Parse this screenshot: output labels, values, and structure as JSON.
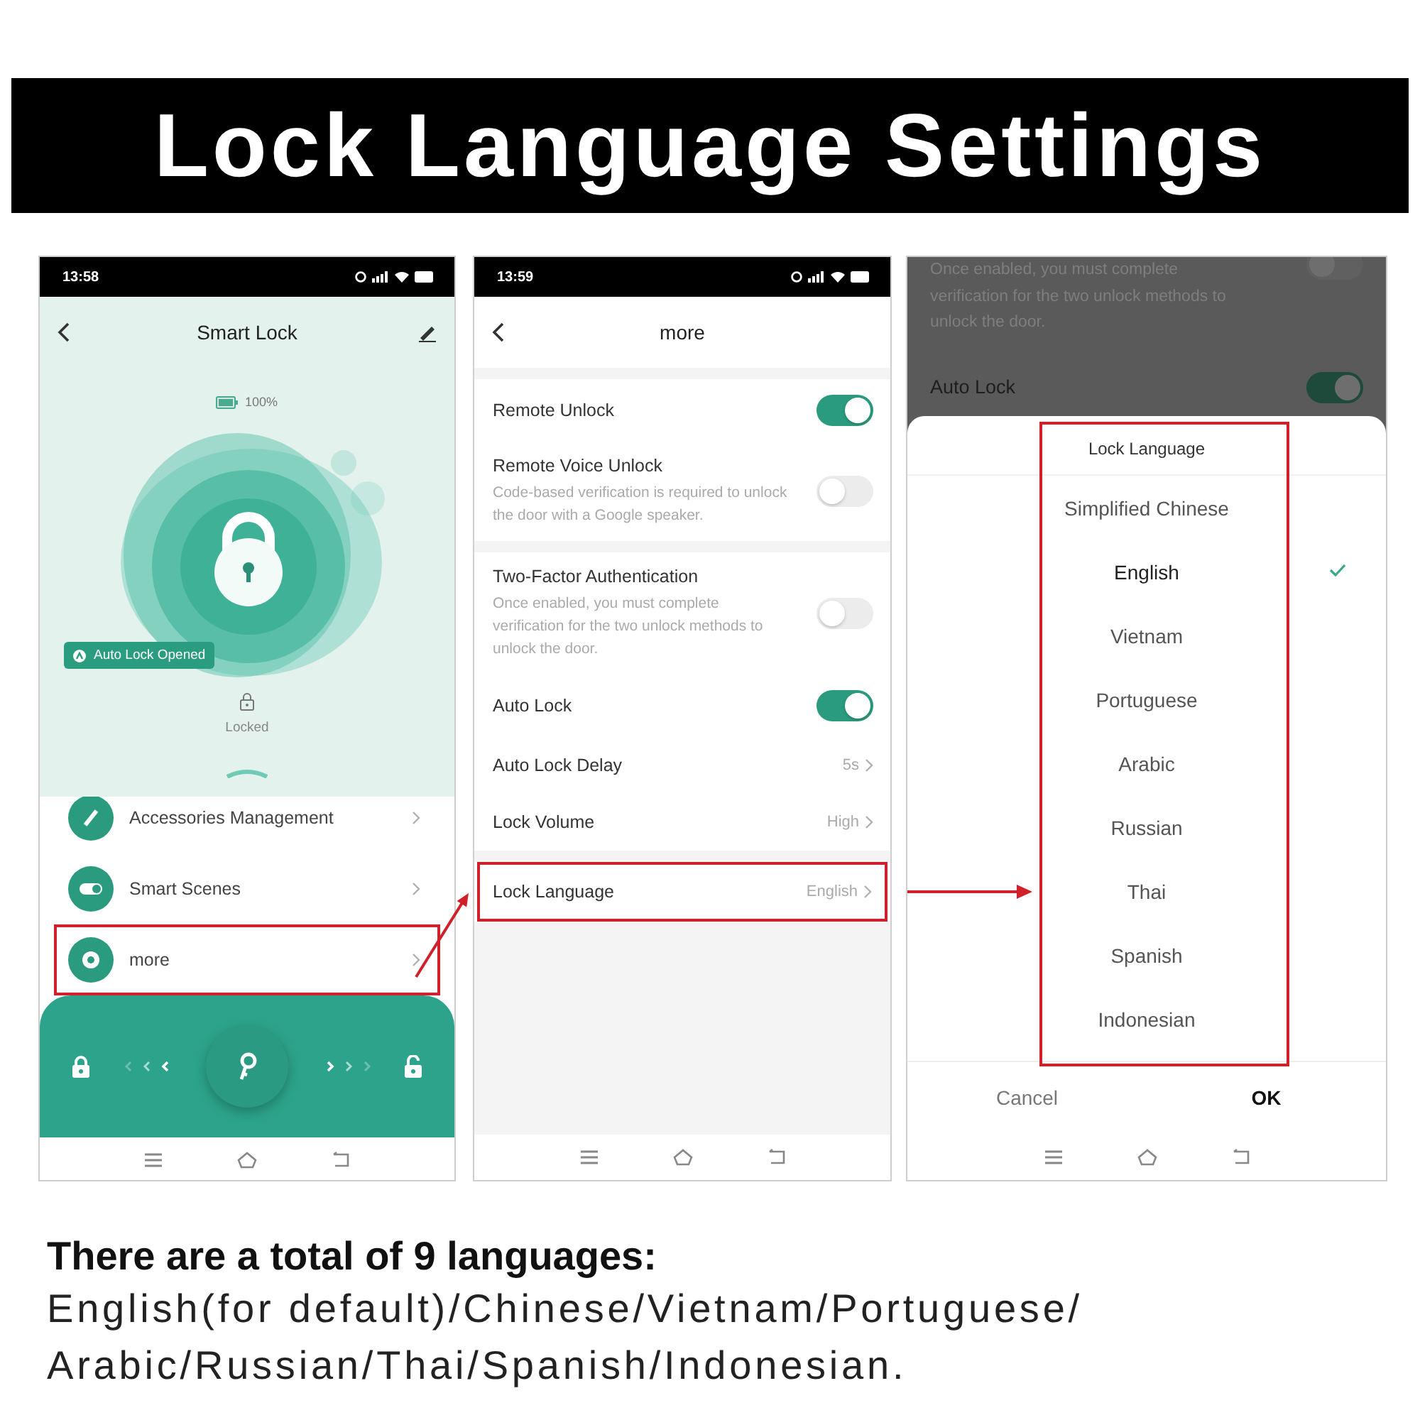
{
  "title": "Lock Language Settings",
  "screens": [
    {
      "kind": "home",
      "status_time": "13:58",
      "title": "Smart Lock",
      "battery": "100%",
      "badge": "Auto Lock Opened",
      "lock_state": "Locked",
      "menu": [
        {
          "label": "Accessories Management",
          "highlighted": false
        },
        {
          "label": "Smart Scenes",
          "highlighted": false
        },
        {
          "label": "more",
          "highlighted": true
        }
      ]
    },
    {
      "kind": "settings",
      "status_time": "13:59",
      "title": "more",
      "groups": [
        {
          "items": [
            {
              "kind": "toggle",
              "label": "Remote Unlock",
              "on": true
            },
            {
              "kind": "toggle",
              "label": "Remote Voice Unlock",
              "description": "Code-based verification is required to unlock the door with a Google speaker.",
              "on": false
            }
          ]
        },
        {
          "items": [
            {
              "kind": "toggle",
              "label": "Two-Factor Authentication",
              "description": "Once enabled, you must complete verification for the two unlock methods to unlock the door.",
              "on": false
            },
            {
              "kind": "toggle",
              "label": "Auto Lock",
              "on": true
            },
            {
              "kind": "link",
              "label": "Auto Lock Delay",
              "value": "5s",
              "highlighted": false
            },
            {
              "kind": "link",
              "label": "Lock Volume",
              "value": "High",
              "highlighted": false
            }
          ]
        },
        {
          "items": [
            {
              "kind": "link",
              "label": "Lock Language",
              "value": "English",
              "highlighted": true
            }
          ]
        }
      ]
    },
    {
      "kind": "picker",
      "background": [
        {
          "kind": "toggle",
          "description": "Once enabled, you must complete verification for the two unlock methods to unlock the door.",
          "on": false
        },
        {
          "kind": "toggle",
          "label": "Auto Lock",
          "on": true
        }
      ],
      "sheet_title": "Lock Language",
      "highlighted": true,
      "options": [
        {
          "label": "Simplified Chinese",
          "selected": false
        },
        {
          "label": "English",
          "selected": true
        },
        {
          "label": "Vietnam",
          "selected": false
        },
        {
          "label": "Portuguese",
          "selected": false
        },
        {
          "label": "Arabic",
          "selected": false
        },
        {
          "label": "Russian",
          "selected": false
        },
        {
          "label": "Thai",
          "selected": false
        },
        {
          "label": "Spanish",
          "selected": false
        },
        {
          "label": "Indonesian",
          "selected": false
        }
      ],
      "buttons": [
        {
          "label": "Cancel",
          "kind": "secondary"
        },
        {
          "label": "OK",
          "kind": "primary"
        }
      ]
    }
  ],
  "caption": {
    "heading": "There are a total of 9 languages:",
    "lines": [
      "English(for default)/Chinese/Vietnam/Portuguese/",
      "Arabic/Russian/Thai/Spanish/Indonesian."
    ]
  }
}
